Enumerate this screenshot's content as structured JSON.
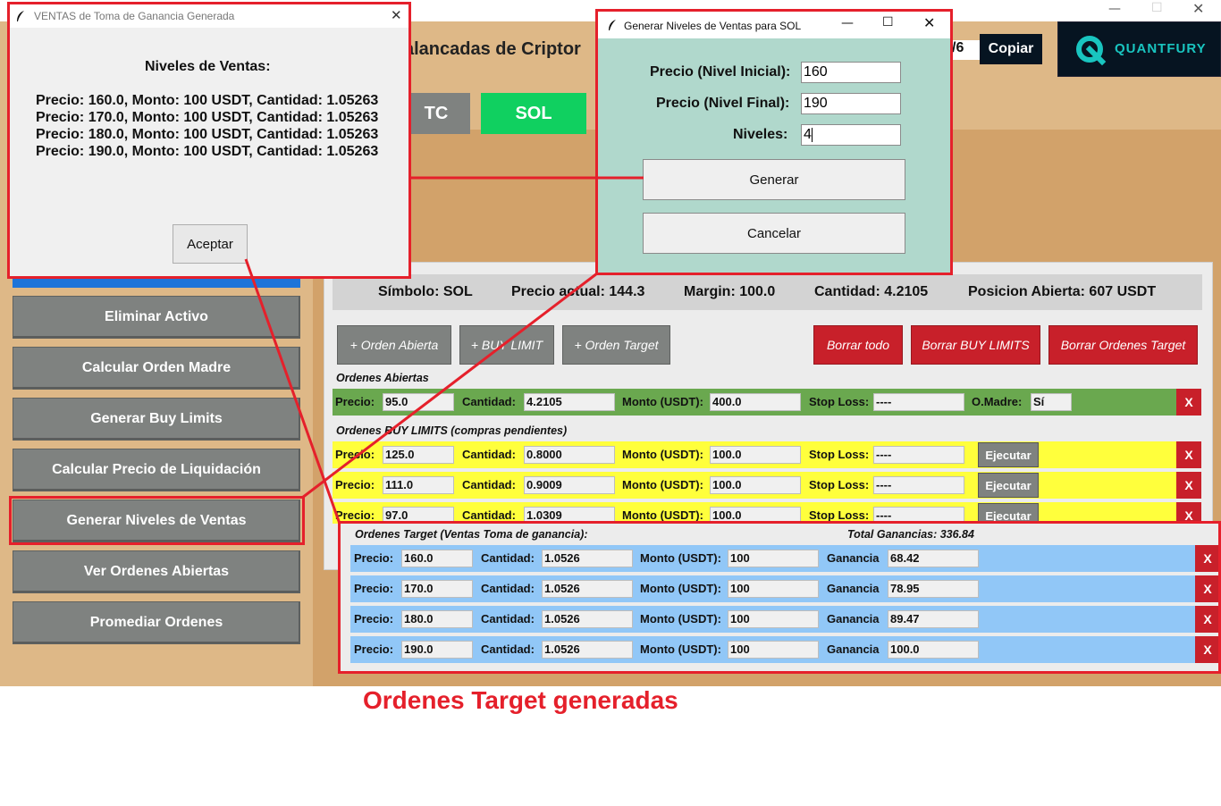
{
  "window": {
    "title": "Herramienta de Operaciones Apalancadas de Criptomonedas",
    "title_visible": "alancadas de Criptor",
    "partial_value": "/6"
  },
  "header": {
    "copy_label": "Copiar",
    "brand": "QUANTFURY"
  },
  "coins": [
    {
      "label": "TC"
    },
    {
      "label": "SOL"
    }
  ],
  "sidebar": {
    "items": [
      {
        "label": "Eliminar Activo"
      },
      {
        "label": "Calcular Orden Madre"
      },
      {
        "label": "Generar Buy Limits"
      },
      {
        "label": "Calcular Precio de Liquidación"
      },
      {
        "label": "Generar Niveles de Ventas"
      },
      {
        "label": "Ver Ordenes Abiertas"
      },
      {
        "label": "Promediar Ordenes"
      }
    ]
  },
  "info": {
    "simbolo": "Símbolo: SOL",
    "precio": "Precio actual: 144.3",
    "margin": "Margin: 100.0",
    "cantidad": "Cantidad: 4.2105",
    "posicion": "Posicion Abierta: 607 USDT"
  },
  "actions": {
    "orden_abierta": "+ Orden Abierta",
    "buy_limit": "+ BUY LIMIT",
    "orden_target": "+ Orden Target",
    "borrar_todo": "Borrar todo",
    "borrar_buy": "Borrar BUY LIMITS",
    "borrar_target": "Borrar Ordenes Target"
  },
  "labels": {
    "precio": "Precio:",
    "cantidad": "Cantidad:",
    "monto": "Monto (USDT):",
    "stop": "Stop Loss:",
    "omadre": "O.Madre:",
    "ganancia": "Ganancia",
    "ejecutar": "Ejecutar",
    "x": "X"
  },
  "open_orders": {
    "header": "Ordenes Abiertas",
    "rows": [
      {
        "precio": "95.0",
        "cantidad": "4.2105",
        "monto": "400.0",
        "stop": "----",
        "omadre": "Sí"
      }
    ]
  },
  "buy_limits": {
    "header": "Ordenes BUY LIMITS (compras pendientes)",
    "rows": [
      {
        "precio": "125.0",
        "cantidad": "0.8000",
        "monto": "100.0",
        "stop": "----"
      },
      {
        "precio": "111.0",
        "cantidad": "0.9009",
        "monto": "100.0",
        "stop": "----"
      },
      {
        "precio": "97.0",
        "cantidad": "1.0309",
        "monto": "100.0",
        "stop": "----"
      }
    ]
  },
  "targets": {
    "header": "Ordenes Target (Ventas Toma de ganancia):",
    "total": "Total Ganancias: 336.84",
    "rows": [
      {
        "precio": "160.0",
        "cantidad": "1.0526",
        "monto": "100",
        "ganancia": "68.42"
      },
      {
        "precio": "170.0",
        "cantidad": "1.0526",
        "monto": "100",
        "ganancia": "78.95"
      },
      {
        "precio": "180.0",
        "cantidad": "1.0526",
        "monto": "100",
        "ganancia": "89.47"
      },
      {
        "precio": "190.0",
        "cantidad": "1.0526",
        "monto": "100",
        "ganancia": "100.0"
      }
    ]
  },
  "popup_result": {
    "title": "VENTAS de Toma de Ganancia Generada",
    "heading": "Niveles de Ventas:",
    "lines": [
      "Precio: 160.0, Monto: 100 USDT, Cantidad: 1.05263",
      "Precio: 170.0, Monto: 100 USDT, Cantidad: 1.05263",
      "Precio: 180.0, Monto: 100 USDT, Cantidad: 1.05263",
      "Precio: 190.0, Monto: 100 USDT, Cantidad: 1.05263"
    ],
    "accept": "Aceptar"
  },
  "popup_generate": {
    "title": "Generar Niveles de Ventas para SOL",
    "inicial_label": "Precio (Nivel Inicial):",
    "inicial_value": "160",
    "final_label": "Precio (Nivel Final):",
    "final_value": "190",
    "niveles_label": "Niveles:",
    "niveles_value": "4",
    "generar": "Generar",
    "cancelar": "Cancelar"
  },
  "caption": "Ordenes Target generadas",
  "colors": {
    "annotation_red": "#e5202b",
    "background_tan": "#deb887",
    "sol_green": "#10d060",
    "row_green": "#6aa84f",
    "row_yellow": "#ffff3c",
    "row_blue": "#91c7f7",
    "button_red": "#c8202a"
  }
}
